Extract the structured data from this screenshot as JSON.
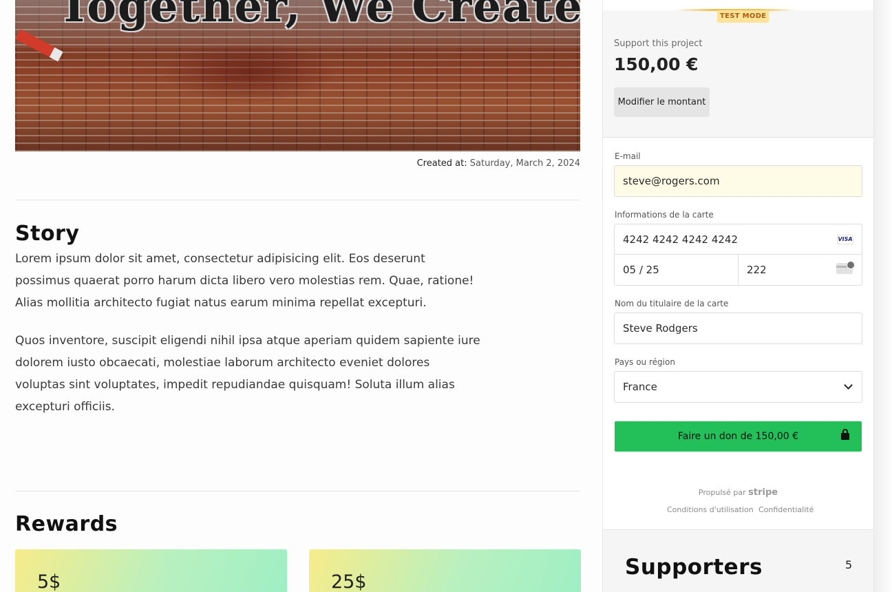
{
  "hero": {
    "text": "Together, We Create!"
  },
  "meta": {
    "created_label": "Created at:",
    "created_value": "Saturday, March 2, 2024"
  },
  "story": {
    "title": "Story",
    "paragraphs": [
      "Lorem ipsum dolor sit amet, consectetur adipisicing elit. Eos deserunt possimus quaerat porro harum dicta libero vero molestias rem. Quae, ratione! Alias mollitia architecto fugiat natus earum minima repellat excepturi.",
      "Quos inventore, suscipit eligendi nihil ipsa atque aperiam quidem sapiente iure dolorem iusto obcaecati, molestiae laborum architecto eveniet dolores voluptas sint voluptates, impedit repudiandae quisquam! Soluta illum alias excepturi officiis."
    ]
  },
  "rewards": {
    "title": "Rewards",
    "items": [
      {
        "amount": "5$"
      },
      {
        "amount": "25$"
      }
    ]
  },
  "checkout": {
    "test_badge": "TEST MODE",
    "support_label": "Support this project",
    "amount": "150,00 €",
    "modify_label": "Modifier le montant",
    "email_label": "E-mail",
    "email_value": "steve@rogers.com",
    "card_label": "Informations de la carte",
    "card_number": "4242 4242 4242 4242",
    "card_brand": "VISA",
    "card_expiry": "05 / 25",
    "card_cvc": "222",
    "holder_label": "Nom du titulaire de la carte",
    "holder_value": "Steve Rodgers",
    "country_label": "Pays ou région",
    "country_value": "France",
    "pay_label": "Faire un don de 150,00 €",
    "powered_by": "Propulsé par",
    "powered_brand": "stripe",
    "terms": "Conditions d'utilisation",
    "privacy": "Confidentialité",
    "accent_color": "#23c05a"
  },
  "supporters": {
    "title": "Supporters",
    "count": "5"
  }
}
